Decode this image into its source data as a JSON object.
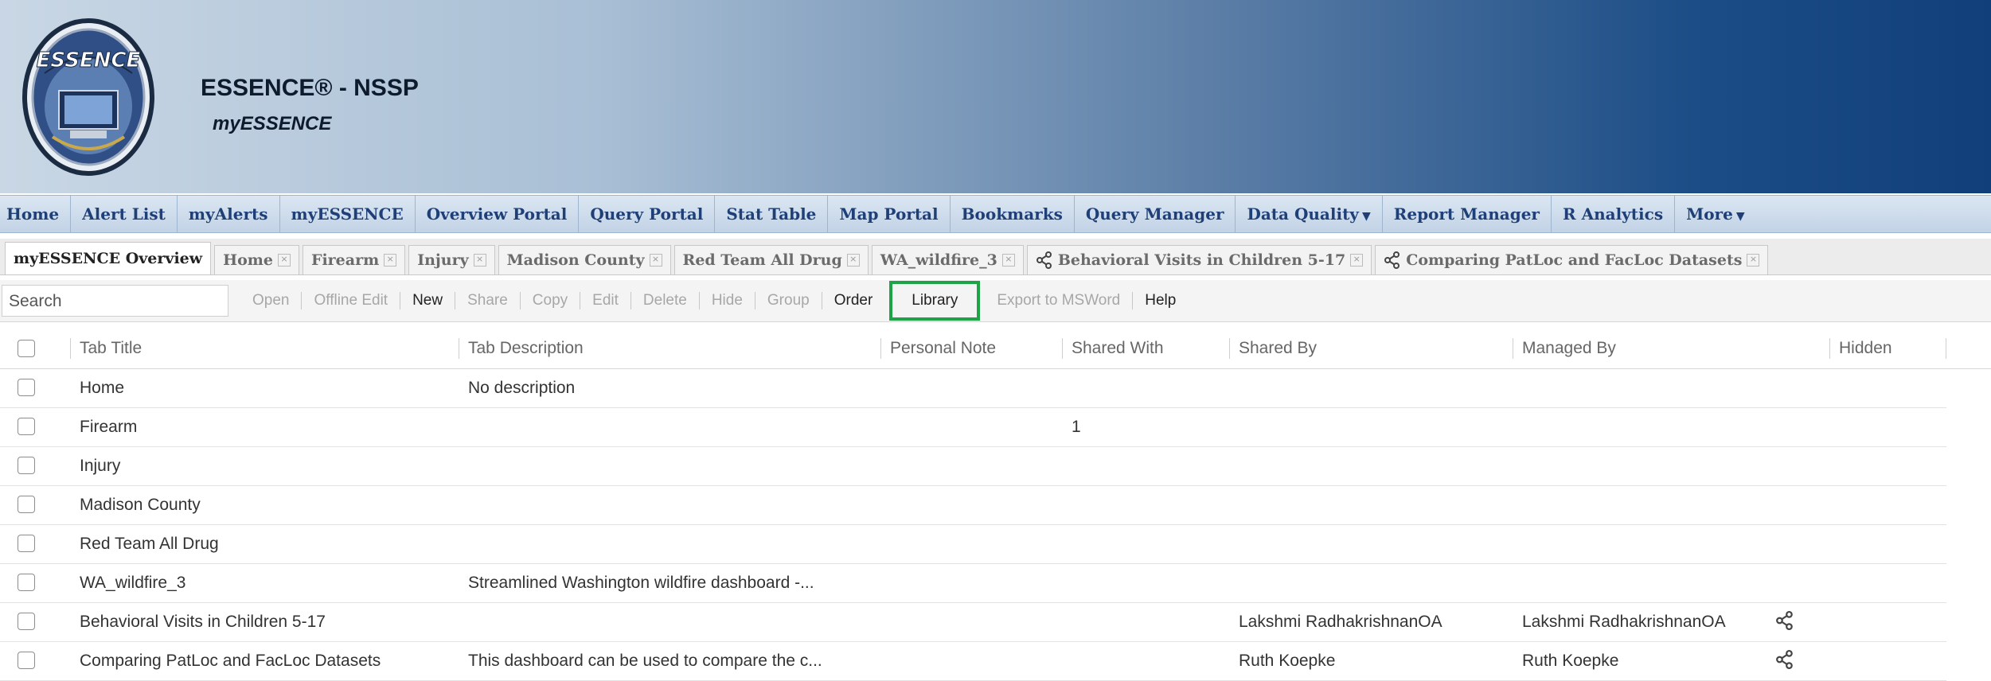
{
  "app": {
    "title": "ESSENCE® - NSSP",
    "subtitle": "myESSENCE",
    "logo_text": "ESSENCE"
  },
  "nav": [
    {
      "label": "Home"
    },
    {
      "label": "Alert List"
    },
    {
      "label": "myAlerts"
    },
    {
      "label": "myESSENCE"
    },
    {
      "label": "Overview Portal"
    },
    {
      "label": "Query Portal"
    },
    {
      "label": "Stat Table"
    },
    {
      "label": "Map Portal"
    },
    {
      "label": "Bookmarks"
    },
    {
      "label": "Query Manager"
    },
    {
      "label": "Data Quality",
      "dropdown": true
    },
    {
      "label": "Report Manager"
    },
    {
      "label": "R Analytics"
    },
    {
      "label": "More",
      "dropdown": true
    }
  ],
  "tabs": [
    {
      "label": "myESSENCE Overview",
      "active": true
    },
    {
      "label": "Home",
      "closable": true
    },
    {
      "label": "Firearm",
      "closable": true
    },
    {
      "label": "Injury",
      "closable": true
    },
    {
      "label": "Madison County",
      "closable": true
    },
    {
      "label": "Red Team All Drug",
      "closable": true
    },
    {
      "label": "WA_wildfire_3",
      "closable": true
    },
    {
      "label": "Behavioral Visits in Children 5-17",
      "closable": true,
      "shared": true
    },
    {
      "label": "Comparing PatLoc and FacLoc Datasets",
      "closable": true,
      "shared": true
    }
  ],
  "toolbar": {
    "search_placeholder": "Search",
    "open": "Open",
    "offline_edit": "Offline Edit",
    "new": "New",
    "share": "Share",
    "copy": "Copy",
    "edit": "Edit",
    "delete": "Delete",
    "hide": "Hide",
    "group": "Group",
    "order": "Order",
    "library": "Library",
    "export": "Export to MSWord",
    "help": "Help",
    "highlight_color": "#1ea446"
  },
  "grid": {
    "headers": {
      "title": "Tab Title",
      "description": "Tab Description",
      "note": "Personal Note",
      "shared_with": "Shared With",
      "shared_by": "Shared By",
      "managed_by": "Managed By",
      "hidden": "Hidden"
    },
    "rows": [
      {
        "title": "Home",
        "description": "No description",
        "note": "",
        "shared_with": "",
        "shared_by": "",
        "managed_by": "",
        "shared_icon": false
      },
      {
        "title": "Firearm",
        "description": "",
        "note": "",
        "shared_with": "1",
        "shared_by": "",
        "managed_by": "",
        "shared_icon": false
      },
      {
        "title": "Injury",
        "description": "",
        "note": "",
        "shared_with": "",
        "shared_by": "",
        "managed_by": "",
        "shared_icon": false
      },
      {
        "title": "Madison County",
        "description": "",
        "note": "",
        "shared_with": "",
        "shared_by": "",
        "managed_by": "",
        "shared_icon": false
      },
      {
        "title": "Red Team All Drug",
        "description": "",
        "note": "",
        "shared_with": "",
        "shared_by": "",
        "managed_by": "",
        "shared_icon": false
      },
      {
        "title": "WA_wildfire_3",
        "description": "Streamlined Washington wildfire dashboard -...",
        "note": "",
        "shared_with": "",
        "shared_by": "",
        "managed_by": "",
        "shared_icon": false
      },
      {
        "title": "Behavioral Visits in Children 5-17",
        "description": "",
        "note": "",
        "shared_with": "",
        "shared_by": "Lakshmi RadhakrishnanOA",
        "managed_by": "Lakshmi RadhakrishnanOA",
        "shared_icon": true
      },
      {
        "title": "Comparing PatLoc and FacLoc Datasets",
        "description": "This dashboard can be used to compare the c...",
        "note": "",
        "shared_with": "",
        "shared_by": "Ruth Koepke",
        "managed_by": "Ruth Koepke",
        "shared_icon": true
      }
    ]
  }
}
